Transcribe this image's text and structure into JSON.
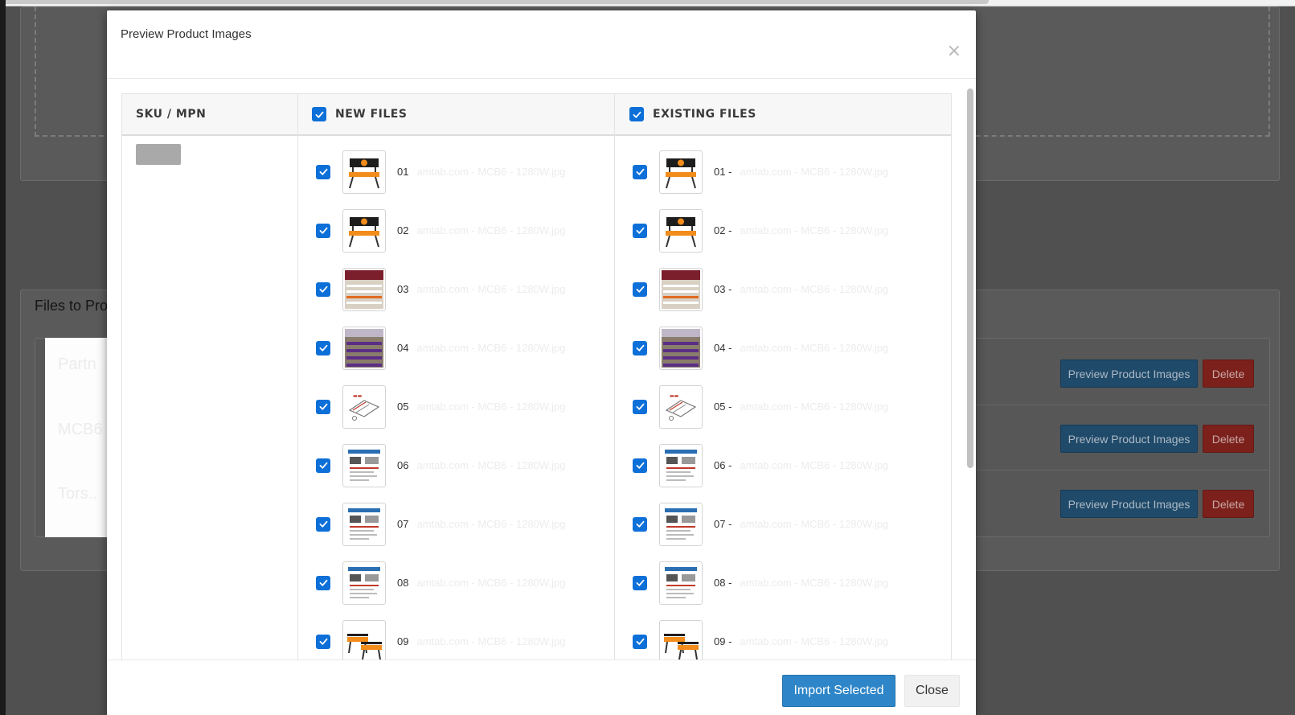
{
  "modal": {
    "title": "Preview Product Images",
    "close_glyph": "×",
    "columns": {
      "sku": "SKU / MPN",
      "new_files": "NEW FILES",
      "existing_files": "EXISTING FILES"
    },
    "new_files": [
      {
        "num": "01",
        "rest": "amtab.com - MCB6 - 1280W.jpg",
        "thumb": "bench-orange-banner"
      },
      {
        "num": "02",
        "rest": "amtab.com - MCB6 - 1280W.jpg",
        "thumb": "bench-orange-banner"
      },
      {
        "num": "03",
        "rest": "amtab.com - MCB6 - 1280W.jpg",
        "thumb": "bleachers-gym"
      },
      {
        "num": "04",
        "rest": "amtab.com - MCB6 - 1280W.jpg",
        "thumb": "bleachers-purple"
      },
      {
        "num": "05",
        "rest": "amtab.com - MCB6 - 1280W.jpg",
        "thumb": "diagram-sketch"
      },
      {
        "num": "06",
        "rest": "amtab.com - MCB6 - 1280W.jpg",
        "thumb": "spec-sheet"
      },
      {
        "num": "07",
        "rest": "amtab.com - MCB6 - 1280W.jpg",
        "thumb": "spec-sheet"
      },
      {
        "num": "08",
        "rest": "amtab.com - MCB6 - 1280W.jpg",
        "thumb": "spec-sheet"
      },
      {
        "num": "09",
        "rest": "amtab.com - MCB6 - 1280W.jpg",
        "thumb": "bench-orange"
      }
    ],
    "existing_files": [
      {
        "num": "01 -",
        "rest": "amtab.com - MCB6 - 1280W.jpg",
        "thumb": "bench-orange-banner"
      },
      {
        "num": "02 -",
        "rest": "amtab.com - MCB6 - 1280W.jpg",
        "thumb": "bench-orange-banner"
      },
      {
        "num": "03 -",
        "rest": "amtab.com - MCB6 - 1280W.jpg",
        "thumb": "bleachers-gym"
      },
      {
        "num": "04 -",
        "rest": "amtab.com - MCB6 - 1280W.jpg",
        "thumb": "bleachers-purple"
      },
      {
        "num": "05 -",
        "rest": "amtab.com - MCB6 - 1280W.jpg",
        "thumb": "diagram-sketch"
      },
      {
        "num": "06 -",
        "rest": "amtab.com - MCB6 - 1280W.jpg",
        "thumb": "spec-sheet"
      },
      {
        "num": "07 -",
        "rest": "amtab.com - MCB6 - 1280W.jpg",
        "thumb": "spec-sheet"
      },
      {
        "num": "08 -",
        "rest": "amtab.com - MCB6 - 1280W.jpg",
        "thumb": "spec-sheet"
      },
      {
        "num": "09 -",
        "rest": "amtab.com - MCB6 - 1280W.jpg",
        "thumb": "bench-orange"
      }
    ],
    "footer": {
      "import_label": "Import Selected",
      "close_label": "Close"
    }
  },
  "background": {
    "heading": "Files to Pro",
    "rows": [
      {
        "name": "Partn",
        "preview_label": "Preview Product Images",
        "delete_label": "Delete"
      },
      {
        "name": "MCB6",
        "preview_label": "Preview Product Images",
        "delete_label": "Delete"
      },
      {
        "name": "Tors..",
        "preview_label": "Preview Product Images",
        "delete_label": "Delete"
      }
    ]
  },
  "colors": {
    "primary": "#2e86c8",
    "checkbox": "#0d6fd8",
    "delete": "#7b201b"
  }
}
